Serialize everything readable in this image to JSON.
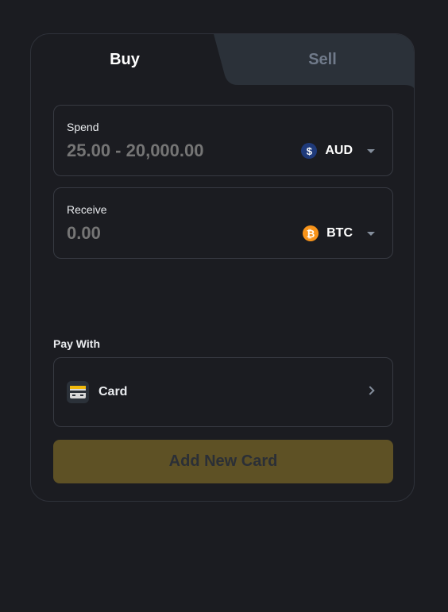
{
  "tabs": {
    "buy_label": "Buy",
    "sell_label": "Sell",
    "active": "Buy"
  },
  "spend": {
    "label": "Spend",
    "placeholder": "25.00 - 20,000.00",
    "value": "",
    "currency": "AUD",
    "currency_icon": "dollar-coin-icon",
    "currency_symbol": "$"
  },
  "receive": {
    "label": "Receive",
    "placeholder": "0.00",
    "value": "",
    "currency": "BTC",
    "currency_icon": "bitcoin-icon",
    "currency_symbol": "₿"
  },
  "pay_with": {
    "label": "Pay With",
    "method_label": "Card",
    "method_icon": "credit-card-icon"
  },
  "add_card_button": "Add New Card",
  "colors": {
    "background": "#1b1c21",
    "tab_inactive": "#2b3139",
    "accent_disabled": "#5e5125",
    "aud_coin": "#1f3a7a",
    "btc_coin": "#f7931a"
  }
}
